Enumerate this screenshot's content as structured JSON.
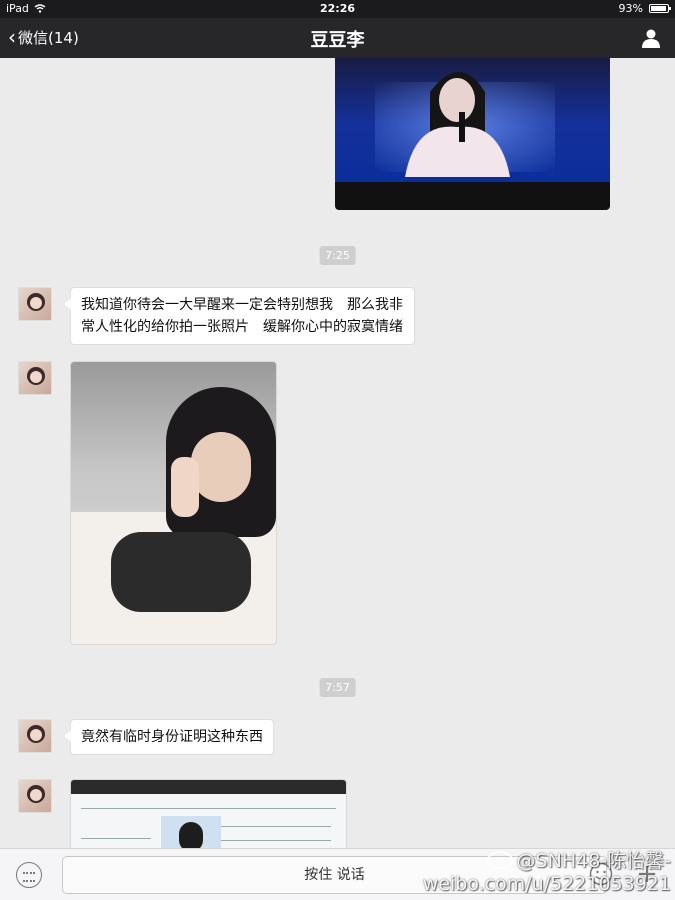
{
  "status_bar": {
    "device": "iPad",
    "time": "22:26",
    "battery": "93%",
    "battery_level": 0.93
  },
  "nav": {
    "back_label": "微信(14)",
    "title": "豆豆李"
  },
  "messages": [
    {
      "type": "timestamp",
      "text": "7:25"
    },
    {
      "type": "text",
      "lines": [
        "我知道你待会一大早醒来一定会特别想我　那么我非",
        "常人性化的给你拍一张照片　缓解你心中的寂寞情绪"
      ]
    },
    {
      "type": "image"
    },
    {
      "type": "timestamp",
      "text": "7:57"
    },
    {
      "type": "text",
      "lines": [
        "竟然有临时身份证明这种东西"
      ]
    },
    {
      "type": "image"
    }
  ],
  "input_bar": {
    "talk_label": "按住 说话"
  },
  "watermark": {
    "line1": "@SNH48-陈怡馨-",
    "line2": "weibo.com/u/5221053921"
  }
}
